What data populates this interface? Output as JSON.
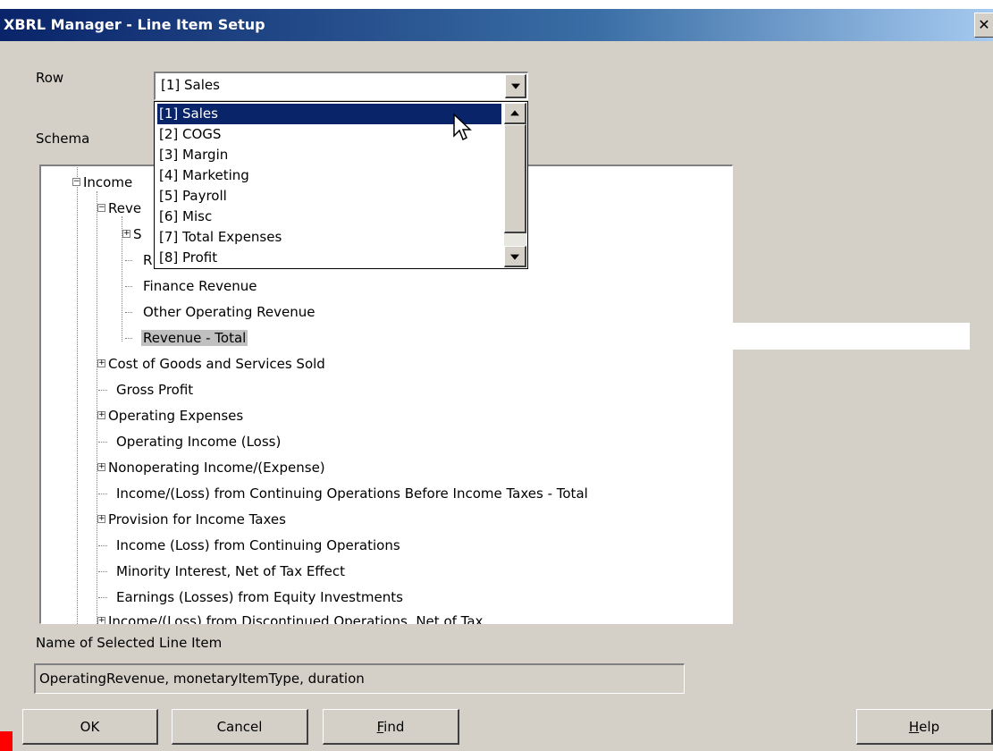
{
  "window": {
    "title": "XBRL Manager - Line Item Setup",
    "close_glyph": "✕"
  },
  "row": {
    "label": "Row",
    "selected_value": "[1]  Sales",
    "options": [
      "[1]  Sales",
      "[2]  COGS",
      "[3]  Margin",
      "[4]  Marketing",
      "[5]  Payroll",
      "[6]  Misc",
      "[7]  Total Expenses",
      "[8]  Profit"
    ],
    "highlighted_index": 0
  },
  "schema": {
    "label": "Schema",
    "tree": [
      {
        "text": "Income",
        "expander": "minus"
      },
      {
        "text": "Reve",
        "expander": "minus"
      },
      {
        "text": "S",
        "expander": "plus"
      },
      {
        "text": "R",
        "expander": "none"
      },
      {
        "text": "Finance Revenue",
        "expander": "none"
      },
      {
        "text": "Other Operating Revenue",
        "expander": "none"
      },
      {
        "text": "Revenue - Total",
        "expander": "none",
        "selected": true
      },
      {
        "text": "Cost of Goods and Services Sold",
        "expander": "plus"
      },
      {
        "text": "Gross Profit",
        "expander": "none"
      },
      {
        "text": "Operating Expenses",
        "expander": "plus"
      },
      {
        "text": "Operating Income (Loss)",
        "expander": "none"
      },
      {
        "text": "Nonoperating Income/(Expense)",
        "expander": "plus"
      },
      {
        "text": "Income/(Loss) from Continuing Operations Before Income Taxes - Total",
        "expander": "none"
      },
      {
        "text": "Provision for Income Taxes",
        "expander": "plus"
      },
      {
        "text": "Income (Loss) from Continuing Operations",
        "expander": "none"
      },
      {
        "text": "Minority Interest, Net of Tax Effect",
        "expander": "none"
      },
      {
        "text": "Earnings (Losses) from Equity Investments",
        "expander": "none"
      },
      {
        "text": "Income/(Loss) from Discontinued Operations, Net of Tax",
        "expander": "plus"
      }
    ]
  },
  "selected_item": {
    "label": "Name of Selected Line Item",
    "value": "OperatingRevenue, monetaryItemType, duration"
  },
  "buttons": {
    "ok": "OK",
    "cancel": "Cancel",
    "find_prefix": "",
    "find_accel": "F",
    "find_rest": "ind",
    "help_accel": "H",
    "help_rest": "elp"
  },
  "colors": {
    "highlight": "#0a246a",
    "dialog_bg": "#d4d0c8"
  }
}
